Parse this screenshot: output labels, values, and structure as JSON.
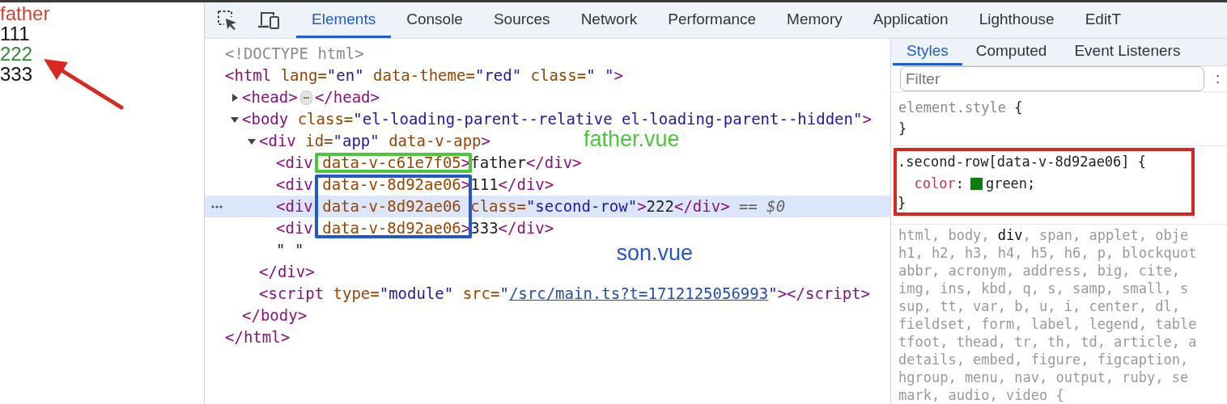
{
  "page_preview": {
    "lines": [
      {
        "text": "father",
        "color": "#d4452f"
      },
      {
        "text": "111",
        "color": "#111111"
      },
      {
        "text": "222",
        "color": "#2e8a2e"
      },
      {
        "text": "333",
        "color": "#111111"
      }
    ]
  },
  "devtools": {
    "tabs": [
      {
        "label": "Elements",
        "selected": true
      },
      {
        "label": "Console",
        "selected": false
      },
      {
        "label": "Sources",
        "selected": false
      },
      {
        "label": "Network",
        "selected": false
      },
      {
        "label": "Performance",
        "selected": false
      },
      {
        "label": "Memory",
        "selected": false
      },
      {
        "label": "Application",
        "selected": false
      },
      {
        "label": "Lighthouse",
        "selected": false
      },
      {
        "label": "EditT",
        "selected": false
      }
    ],
    "annotations": [
      {
        "label": "father.vue",
        "color": "#4cc63c"
      },
      {
        "label": "son.vue",
        "color": "#2457c9"
      }
    ],
    "dom_tree": [
      {
        "selected": false,
        "tokens": [
          {
            "kind": "comment",
            "text": "<!DOCTYPE html>"
          }
        ]
      },
      {
        "selected": false,
        "tokens": [
          {
            "kind": "tag",
            "text": "<html"
          },
          {
            "kind": "attr",
            "text": " lang="
          },
          {
            "kind": "value",
            "text": "\"en\""
          },
          {
            "kind": "attr",
            "text": " data-theme="
          },
          {
            "kind": "value",
            "text": "\"red\""
          },
          {
            "kind": "attr",
            "text": " class="
          },
          {
            "kind": "value",
            "text": "\" \""
          },
          {
            "kind": "tag",
            "text": ">"
          }
        ],
        "children": [
          {
            "selected": false,
            "expanded": false,
            "tokens": [
              {
                "kind": "tag",
                "text": "<head>"
              },
              {
                "kind": "badge",
                "text": "⋯"
              },
              {
                "kind": "tag",
                "text": "</head>"
              }
            ]
          },
          {
            "selected": false,
            "expanded": true,
            "tokens": [
              {
                "kind": "tag",
                "text": "<body"
              },
              {
                "kind": "attr",
                "text": " class="
              },
              {
                "kind": "value",
                "text": "\"el-loading-parent--relative el-loading-parent--hidden\""
              },
              {
                "kind": "tag",
                "text": ">"
              }
            ],
            "children": [
              {
                "selected": false,
                "expanded": true,
                "tokens": [
                  {
                    "kind": "tag",
                    "text": "<div"
                  },
                  {
                    "kind": "attr",
                    "text": " id="
                  },
                  {
                    "kind": "value",
                    "text": "\"app\""
                  },
                  {
                    "kind": "attr",
                    "text": " data-v-app"
                  },
                  {
                    "kind": "tag",
                    "text": ">"
                  }
                ],
                "children": [
                  {
                    "selected": false,
                    "tokens": [
                      {
                        "kind": "tag",
                        "text": "<div"
                      },
                      {
                        "kind": "attr",
                        "text": " data-v-c61e7f05",
                        "color": "#4cc63c"
                      },
                      {
                        "kind": "tag",
                        "text": ">"
                      },
                      {
                        "kind": "text",
                        "text": "father"
                      },
                      {
                        "kind": "tag",
                        "text": "</div>"
                      }
                    ]
                  },
                  {
                    "selected": false,
                    "tokens": [
                      {
                        "kind": "tag",
                        "text": "<div"
                      },
                      {
                        "kind": "attr",
                        "text": " data-v-8d92ae06",
                        "color": "#2457c9"
                      },
                      {
                        "kind": "tag",
                        "text": ">"
                      },
                      {
                        "kind": "text",
                        "text": "111"
                      },
                      {
                        "kind": "tag",
                        "text": "</div>"
                      }
                    ]
                  },
                  {
                    "selected": true,
                    "tokens": [
                      {
                        "kind": "tag",
                        "text": "<div"
                      },
                      {
                        "kind": "attr",
                        "text": " data-v-8d92ae06",
                        "color": "#2457c9"
                      },
                      {
                        "kind": "attr",
                        "text": " class="
                      },
                      {
                        "kind": "value",
                        "text": "\"second-row\""
                      },
                      {
                        "kind": "tag",
                        "text": ">"
                      },
                      {
                        "kind": "text",
                        "text": "222"
                      },
                      {
                        "kind": "tag",
                        "text": "</div>"
                      },
                      {
                        "kind": "hint",
                        "text": "== $0"
                      }
                    ]
                  },
                  {
                    "selected": false,
                    "tokens": [
                      {
                        "kind": "tag",
                        "text": "<div"
                      },
                      {
                        "kind": "attr",
                        "text": " data-v-8d92ae06",
                        "color": "#2457c9"
                      },
                      {
                        "kind": "tag",
                        "text": ">"
                      },
                      {
                        "kind": "text",
                        "text": "333"
                      },
                      {
                        "kind": "tag",
                        "text": "</div>"
                      }
                    ]
                  },
                  {
                    "selected": false,
                    "tokens": [
                      {
                        "kind": "text",
                        "text": "\" \""
                      }
                    ]
                  }
                ],
                "close": [
                  {
                    "kind": "tag",
                    "text": "</div>"
                  }
                ]
              },
              {
                "selected": false,
                "tokens": [
                  {
                    "kind": "tag",
                    "text": "<script"
                  },
                  {
                    "kind": "attr",
                    "text": " type="
                  },
                  {
                    "kind": "value",
                    "text": "\"module\""
                  },
                  {
                    "kind": "attr",
                    "text": " src="
                  },
                  {
                    "kind": "value",
                    "text": "\""
                  },
                  {
                    "kind": "link",
                    "text": "/src/main.ts?t=1712125056993"
                  },
                  {
                    "kind": "value",
                    "text": "\""
                  },
                  {
                    "kind": "tag",
                    "text": "></script>"
                  }
                ]
              }
            ],
            "close": [
              {
                "kind": "tag",
                "text": "</body>"
              }
            ]
          }
        ],
        "close": [
          {
            "kind": "tag",
            "text": "</html>"
          }
        ]
      }
    ]
  },
  "styles_pane": {
    "tabs": [
      {
        "label": "Styles",
        "selected": true
      },
      {
        "label": "Computed",
        "selected": false
      },
      {
        "label": "Event Listeners",
        "selected": false
      }
    ],
    "filter": {
      "placeholder": "Filter"
    },
    "filter_menu": ":",
    "rules": [
      {
        "kind": "inline",
        "selector": "element.style",
        "open": "{",
        "close": "}"
      },
      {
        "kind": "matched",
        "selector": ".second-row[data-v-8d92ae06]",
        "open": "{",
        "declarations": [
          {
            "property": "color",
            "separator": ":",
            "color": "#0b7d0b",
            "value": "green;"
          }
        ],
        "close": "}",
        "callout": true
      },
      {
        "kind": "user_agent",
        "lines": [
          [
            {
              "text": "html, body, ",
              "matched": false
            },
            {
              "text": "div",
              "matched": true
            },
            {
              "text": ", span, applet, obje",
              "matched": false
            }
          ],
          [
            {
              "text": "h1, h2, h3, h4, h5, h6, p, blockquot",
              "matched": false
            }
          ],
          [
            {
              "text": "abbr, acronym, address, big, cite,",
              "matched": false
            }
          ],
          [
            {
              "text": "img, ins, kbd, q, s, samp, small, s",
              "matched": false
            }
          ],
          [
            {
              "text": "sup, tt, var, b, u, i, center, dl,",
              "matched": false
            }
          ],
          [
            {
              "text": "fieldset, form, label, legend, table",
              "matched": false
            }
          ],
          [
            {
              "text": "tfoot, thead, tr, th, td, article, a",
              "matched": false
            }
          ],
          [
            {
              "text": "details, embed, figure, figcaption,",
              "matched": false
            }
          ],
          [
            {
              "text": "hgroup, menu, nav, output, ruby, se",
              "matched": false
            }
          ],
          [
            {
              "text": "mark, audio, video {",
              "matched": false
            }
          ]
        ]
      }
    ]
  }
}
